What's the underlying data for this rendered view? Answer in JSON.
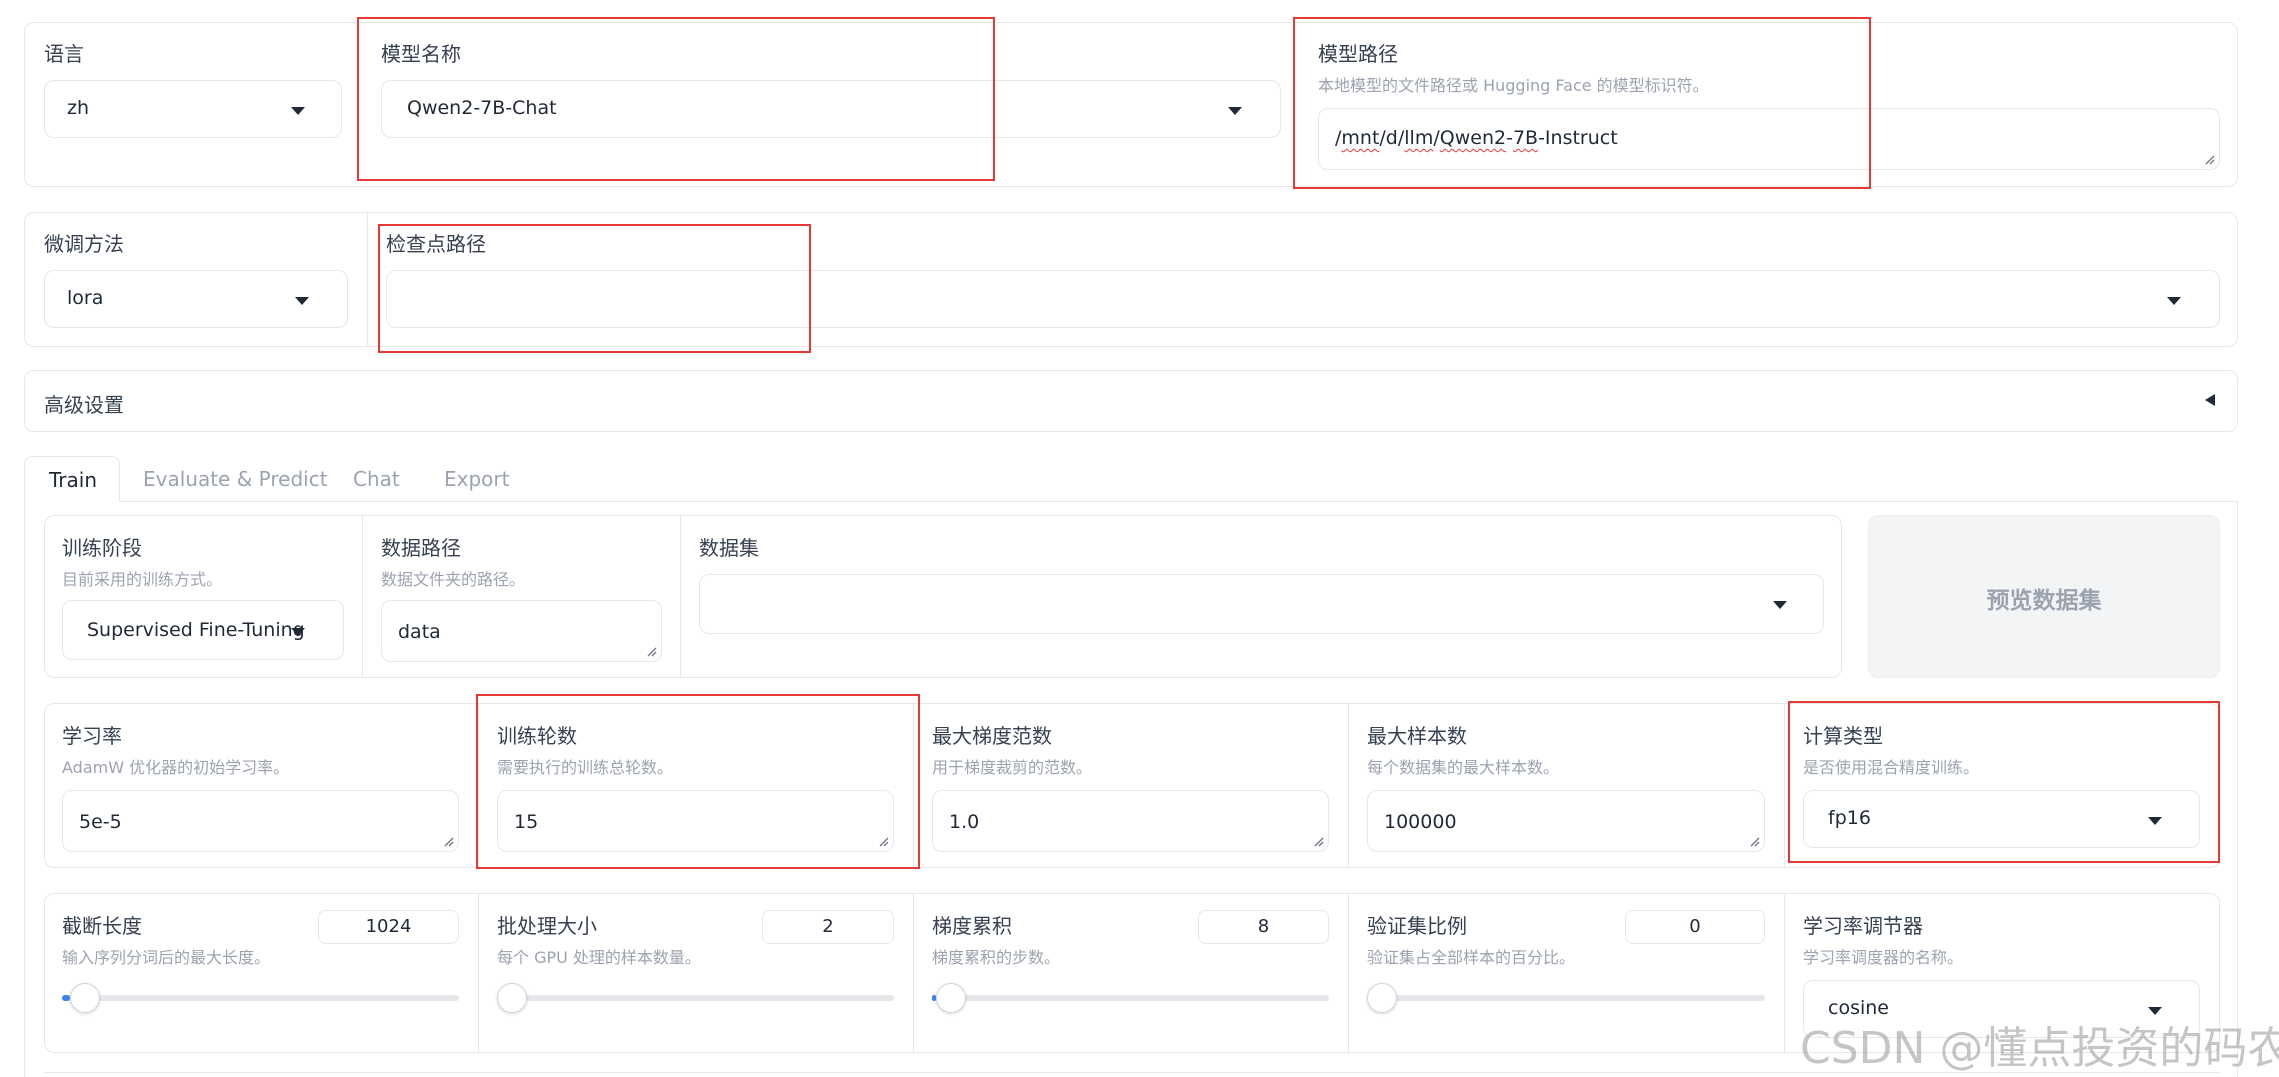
{
  "top_row": {
    "language": {
      "label": "语言",
      "value": "zh"
    },
    "model_name": {
      "label": "模型名称",
      "value": "Qwen2-7B-Chat"
    },
    "model_path": {
      "label": "模型路径",
      "desc": "本地模型的文件路径或 Hugging Face 的模型标识符。",
      "value_parts": [
        "/",
        "mnt",
        "/d/",
        "llm",
        "/",
        "Qwen2",
        "-",
        "7B",
        "-Instruct"
      ]
    }
  },
  "second_row": {
    "finetune": {
      "label": "微调方法",
      "value": "lora"
    },
    "checkpoint": {
      "label": "检查点路径",
      "value": ""
    }
  },
  "advanced": {
    "label": "高级设置",
    "toggle_icon": "triangle-left-icon"
  },
  "tabs": [
    {
      "label": "Train",
      "active": true
    },
    {
      "label": "Evaluate & Predict",
      "active": false
    },
    {
      "label": "Chat",
      "active": false
    },
    {
      "label": "Export",
      "active": false
    }
  ],
  "train": {
    "stage": {
      "label": "训练阶段",
      "desc": "目前采用的训练方式。",
      "value": "Supervised Fine-Tuning"
    },
    "data_dir": {
      "label": "数据路径",
      "desc": "数据文件夹的路径。",
      "value": "data"
    },
    "dataset": {
      "label": "数据集",
      "value": ""
    },
    "preview_button": "预览数据集",
    "learning_rate": {
      "label": "学习率",
      "desc": "AdamW 优化器的初始学习率。",
      "value": "5e-5"
    },
    "epochs": {
      "label": "训练轮数",
      "desc": "需要执行的训练总轮数。",
      "value": "15"
    },
    "max_grad_norm": {
      "label": "最大梯度范数",
      "desc": "用于梯度裁剪的范数。",
      "value": "1.0"
    },
    "max_samples": {
      "label": "最大样本数",
      "desc": "每个数据集的最大样本数。",
      "value": "100000"
    },
    "compute_type": {
      "label": "计算类型",
      "desc": "是否使用混合精度训练。",
      "value": "fp16"
    },
    "cutoff_len": {
      "label": "截断长度",
      "desc": "输入序列分词后的最大长度。",
      "value": "1024",
      "fraction": 0.02
    },
    "batch_size": {
      "label": "批处理大小",
      "desc": "每个 GPU 处理的样本数量。",
      "value": "2",
      "fraction": 0.0
    },
    "grad_accum": {
      "label": "梯度累积",
      "desc": "梯度累积的步数。",
      "value": "8",
      "fraction": 0.01
    },
    "val_size": {
      "label": "验证集比例",
      "desc": "验证集占全部样本的百分比。",
      "value": "0",
      "fraction": 0.0
    },
    "lr_scheduler": {
      "label": "学习率调节器",
      "desc": "学习率调度器的名称。",
      "value": "cosine"
    }
  },
  "watermark": "CSDN @懂点投资的码农"
}
